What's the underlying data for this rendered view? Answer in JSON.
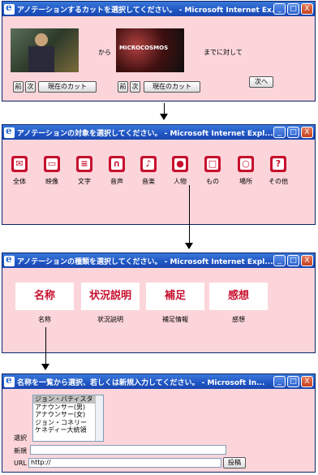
{
  "windows": [
    {
      "title": "アノテーションするカットを選択してください。 - Microsoft Internet Ex..."
    },
    {
      "title": "アノテーションの対象を選択してください。 - Microsoft Internet Expl..."
    },
    {
      "title": "アノテーションの種類を選択してください。 - Microsoft Internet Expl..."
    },
    {
      "title": "名称を一覧から選択、若しくは新規入力してください。 - Microsoft In..."
    }
  ],
  "window_buttons": {
    "minimize": "_",
    "maximize": "□",
    "close": "X"
  },
  "win1": {
    "from": "から",
    "until": "までに対して",
    "prev": "前",
    "next": "次",
    "current_cut": "現在のカット",
    "next_step": "次へ",
    "thumb2_text": "MICROCOSMOS"
  },
  "win2": {
    "targets": [
      {
        "label": "全体",
        "icon": "envelope-icon",
        "glyph": "✉"
      },
      {
        "label": "映像",
        "icon": "monitor-icon",
        "glyph": "▭"
      },
      {
        "label": "文字",
        "icon": "document-icon",
        "glyph": "≡"
      },
      {
        "label": "音声",
        "icon": "headphones-icon",
        "glyph": "∩"
      },
      {
        "label": "音楽",
        "icon": "music-icon",
        "glyph": "♪"
      },
      {
        "label": "人物",
        "icon": "person-icon",
        "glyph": "●"
      },
      {
        "label": "もの",
        "icon": "box-icon",
        "glyph": "□"
      },
      {
        "label": "場所",
        "icon": "magnifier-icon",
        "glyph": "○"
      },
      {
        "label": "その他",
        "icon": "question-icon",
        "glyph": "?"
      }
    ]
  },
  "win3": {
    "types": [
      {
        "card": "名称",
        "label": "名称"
      },
      {
        "card": "状況説明",
        "label": "状況説明"
      },
      {
        "card": "補足",
        "label": "補足情報"
      },
      {
        "card": "感想",
        "label": "感想"
      }
    ]
  },
  "win4": {
    "list": [
      "ジョン・バティスタ",
      "アナウンサー(男)",
      "アナウンサー(女)",
      "ジョン・コネリー",
      "ケネディー大統領"
    ],
    "select_label": "選択",
    "new_label": "新規",
    "url_label": "URL",
    "url_value": "http://",
    "new_value": "",
    "submit": "投稿"
  },
  "colors": {
    "accent": "#c8102e",
    "window_bg": "#fbd5da",
    "titlebar": "#1f55c4"
  }
}
